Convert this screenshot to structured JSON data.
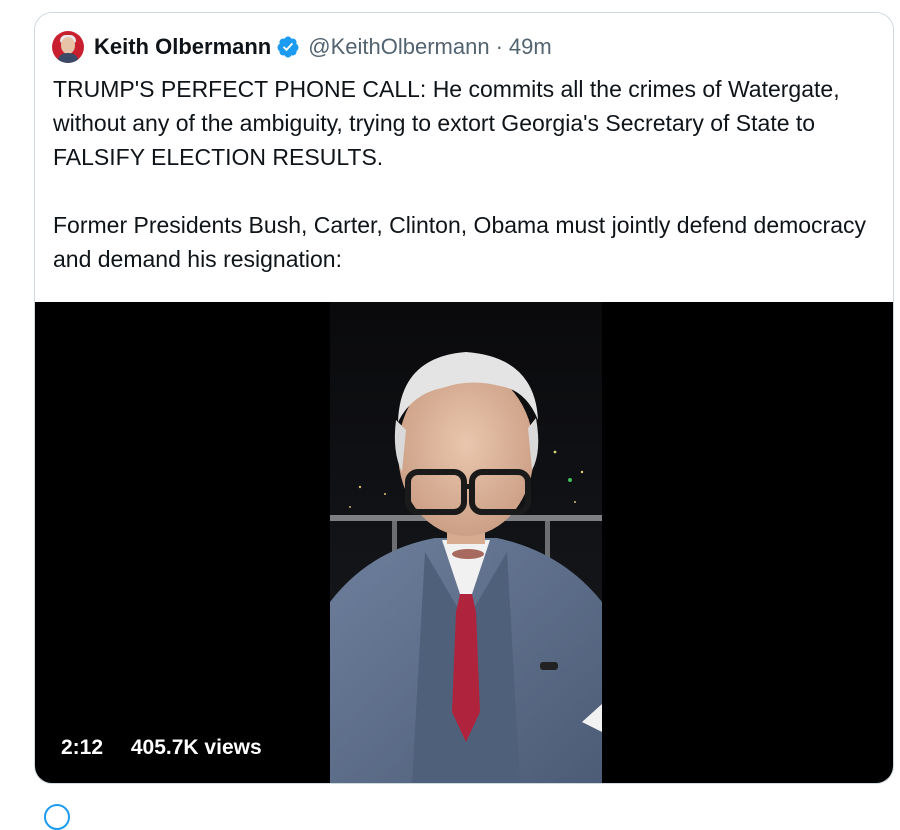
{
  "tweet": {
    "author": {
      "name": "Keith Olbermann",
      "handle": "@KeithOlbermann",
      "verified": true
    },
    "separator": "·",
    "time": "49m",
    "paragraphs": [
      "TRUMP'S PERFECT PHONE CALL: He commits all the crimes of Watergate, without any of the ambiguity, trying to extort Georgia's Secretary of State to FALSIFY ELECTION RESULTS.",
      "Former Presidents Bush, Carter, Clinton, Obama must jointly defend democracy and demand his resignation:"
    ],
    "video": {
      "duration": "2:12",
      "views": "405.7K views"
    }
  },
  "colors": {
    "verified_badge": "#1d9bf0",
    "text_primary": "#0f1419",
    "text_secondary": "#536471",
    "card_border": "#cfd9de"
  },
  "icons": {
    "verified": "verified-badge-icon",
    "avatar": "profile-avatar"
  }
}
